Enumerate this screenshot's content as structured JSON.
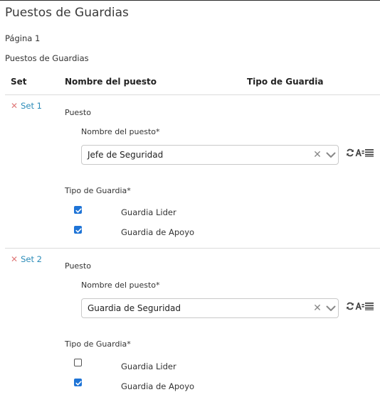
{
  "page": {
    "title": "Puestos de Guardias",
    "page_label": "Página 1",
    "section_title": "Puestos de Guardias"
  },
  "table": {
    "headers": [
      "Set",
      "Nombre del puesto",
      "Tipo de Guardia"
    ]
  },
  "sets": [
    {
      "set_label": "Set 1",
      "puesto_label": "Puesto",
      "nombre_label": "Nombre del puesto*",
      "nombre_value": "Jefe de Seguridad",
      "tipo_label": "Tipo de Guardia*",
      "options": [
        {
          "label": "Guardia Lider",
          "checked": true
        },
        {
          "label": "Guardia de Apoyo",
          "checked": true
        }
      ]
    },
    {
      "set_label": "Set 2",
      "puesto_label": "Puesto",
      "nombre_label": "Nombre del puesto*",
      "nombre_value": "Guardia de Seguridad",
      "tipo_label": "Tipo de Guardia*",
      "options": [
        {
          "label": "Guardia Lider",
          "checked": false
        },
        {
          "label": "Guardia de Apoyo",
          "checked": true
        }
      ]
    }
  ],
  "icons": {
    "remove": "close-icon",
    "clear": "clear-icon",
    "dropdown": "chevron-down-icon",
    "refresh": "refresh-icon",
    "sort_alpha": "sort-alpha-icon",
    "list": "list-icon"
  },
  "colors": {
    "link": "#2a8bb8",
    "remove_x": "#e07a7a",
    "checkbox": "#1f74d6"
  }
}
